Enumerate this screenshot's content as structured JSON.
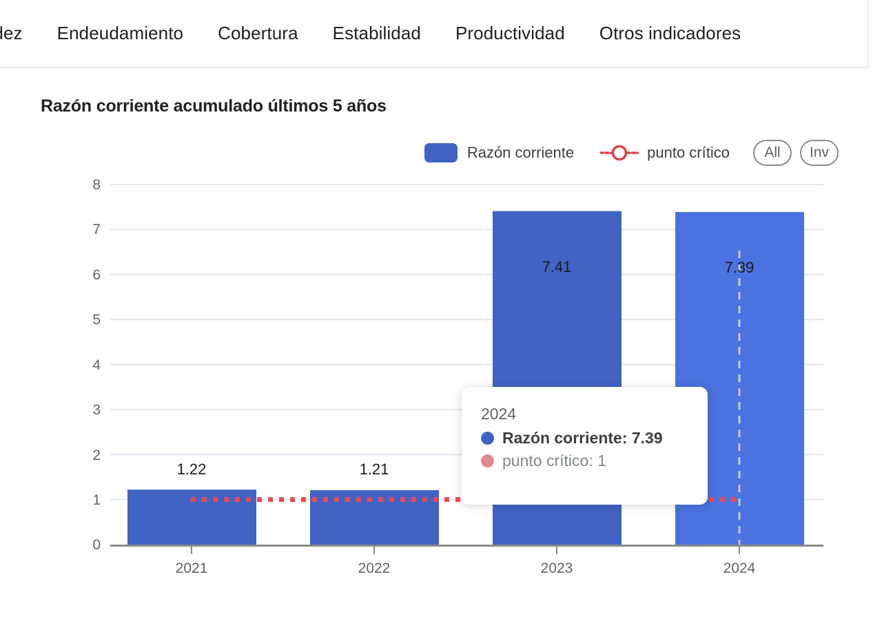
{
  "nav": {
    "tabs": [
      {
        "label": "Liquidez"
      },
      {
        "label": "Endeudamiento"
      },
      {
        "label": "Cobertura"
      },
      {
        "label": "Estabilidad"
      },
      {
        "label": "Productividad"
      },
      {
        "label": "Otros indicadores"
      }
    ]
  },
  "chart": {
    "title": "Razón corriente acumulado últimos 5 años",
    "legend": [
      {
        "label": "Razón corriente",
        "color": "#4063c4",
        "marker": "square-swatch"
      },
      {
        "label": "punto crítico",
        "color": "#d6444e",
        "marker": "dotted-circle"
      }
    ],
    "range_buttons": [
      {
        "label": "All"
      },
      {
        "label": "Inv"
      }
    ]
  },
  "tooltip": {
    "title": "2024",
    "rows": [
      {
        "label": "Razón corriente: 7.39",
        "color": "#4063c4",
        "bold": true
      },
      {
        "label": "punto crítico: 1",
        "color": "#e08a8f",
        "bold": false
      }
    ]
  },
  "chart_data": {
    "type": "bar",
    "title": "Razón corriente acumulado últimos 5 años",
    "xlabel": "",
    "ylabel": "",
    "categories": [
      "2021",
      "2022",
      "2023",
      "2024"
    ],
    "ylim": [
      0,
      8
    ],
    "yticks": [
      "0",
      "1",
      "2",
      "3",
      "4",
      "5",
      "6",
      "7",
      "8"
    ],
    "grid": true,
    "legend_position": "top-right",
    "series": [
      {
        "name": "Razón corriente",
        "type": "bar",
        "color": "#4063c4",
        "values": [
          1.22,
          1.21,
          7.41,
          7.39
        ],
        "labels": [
          "1.22",
          "1.21",
          "7.41",
          "7.39"
        ]
      },
      {
        "name": "punto crítico",
        "type": "line",
        "style": "dotted",
        "color": "#ea4a55",
        "values": [
          1,
          1,
          1,
          1
        ]
      }
    ],
    "highlighted_category": "2024",
    "annotations": {
      "crosshair_at": "2024"
    }
  }
}
